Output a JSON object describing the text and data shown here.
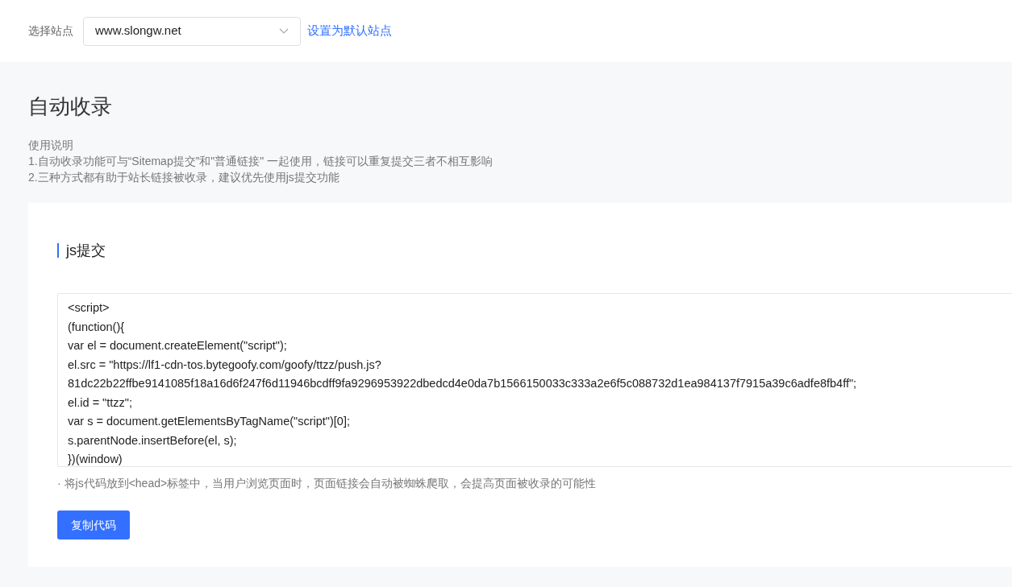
{
  "site_selector": {
    "label": "选择站点",
    "value": "www.slongw.net",
    "link": "设置为默认站点"
  },
  "page": {
    "title": "自动收录",
    "instructions_heading": "使用说明",
    "instructions": [
      "1.自动收录功能可与“Sitemap提交”和\"普通链接\" 一起使用，链接可以重复提交三者不相互影响",
      "2.三种方式都有助于站长链接被收录，建议优先使用js提交功能"
    ]
  },
  "js_section": {
    "title": "js提交",
    "code_lines": [
      "<script>",
      "(function(){",
      "var el = document.createElement(\"script\");",
      "el.src = \"https://lf1-cdn-tos.bytegoofy.com/goofy/ttzz/push.js?",
      "81dc22b22ffbe9141085f18a16d6f247f6d11946bcdff9fa9296953922dbedcd4e0da7b1566150033c333a2e6f5c088732d1ea984137f7915a39c6adfe8fb4ff\";",
      "el.id = \"ttzz\";",
      "var s = document.getElementsByTagName(\"script\")[0];",
      "s.parentNode.insertBefore(el, s);",
      "})(window)"
    ],
    "hint": "· 将js代码放到<head>标签中，当用户浏览页面时，页面链接会自动被蜘蛛爬取，会提高页面被收录的可能性",
    "button": "复制代码"
  }
}
